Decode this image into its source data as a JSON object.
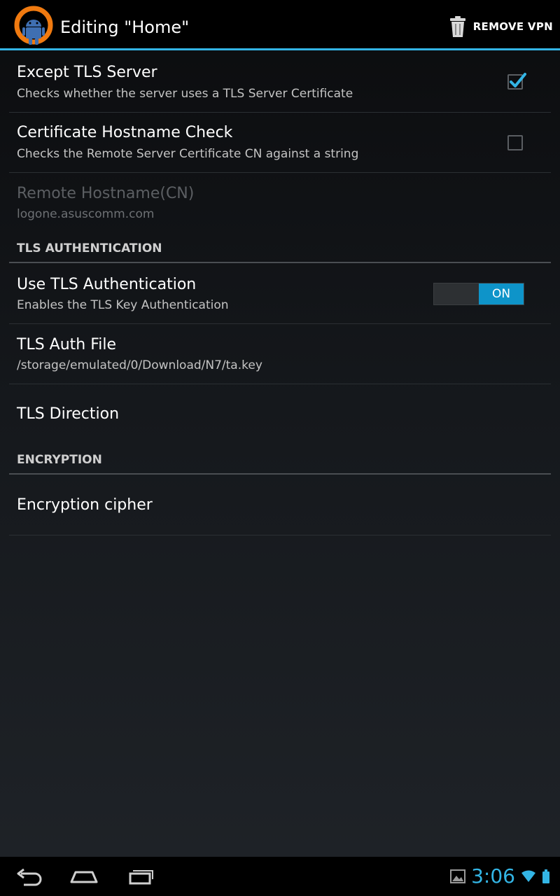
{
  "action_bar": {
    "title": "Editing \"Home\"",
    "remove_label": "REMOVE VPN",
    "accent_color": "#33b5e5"
  },
  "prefs": {
    "except_tls": {
      "title": "Except TLS Server",
      "summary": "Checks whether the server uses a TLS Server Certificate",
      "checked": true
    },
    "hostname_check": {
      "title": "Certificate Hostname Check",
      "summary": "Checks the Remote Server Certificate CN against a string",
      "checked": false
    },
    "remote_hostname": {
      "title": "Remote Hostname(CN)",
      "summary": "logone.asuscomm.com",
      "enabled": false
    },
    "tls_auth_category": "TLS AUTHENTICATION",
    "use_tls_auth": {
      "title": "Use TLS Authentication",
      "summary": "Enables the TLS Key Authentication",
      "switch_label": "ON"
    },
    "tls_auth_file": {
      "title": "TLS Auth File",
      "summary": "/storage/emulated/0/Download/N7/ta.key"
    },
    "tls_direction": {
      "title": "TLS Direction"
    },
    "encryption_category": "ENCRYPTION",
    "encryption_cipher": {
      "title": "Encryption cipher"
    }
  },
  "navbar": {
    "clock": "3:06",
    "icons": [
      "back-icon",
      "home-icon",
      "recent-apps-icon",
      "gallery-notification-icon",
      "wifi-icon",
      "battery-icon"
    ]
  }
}
